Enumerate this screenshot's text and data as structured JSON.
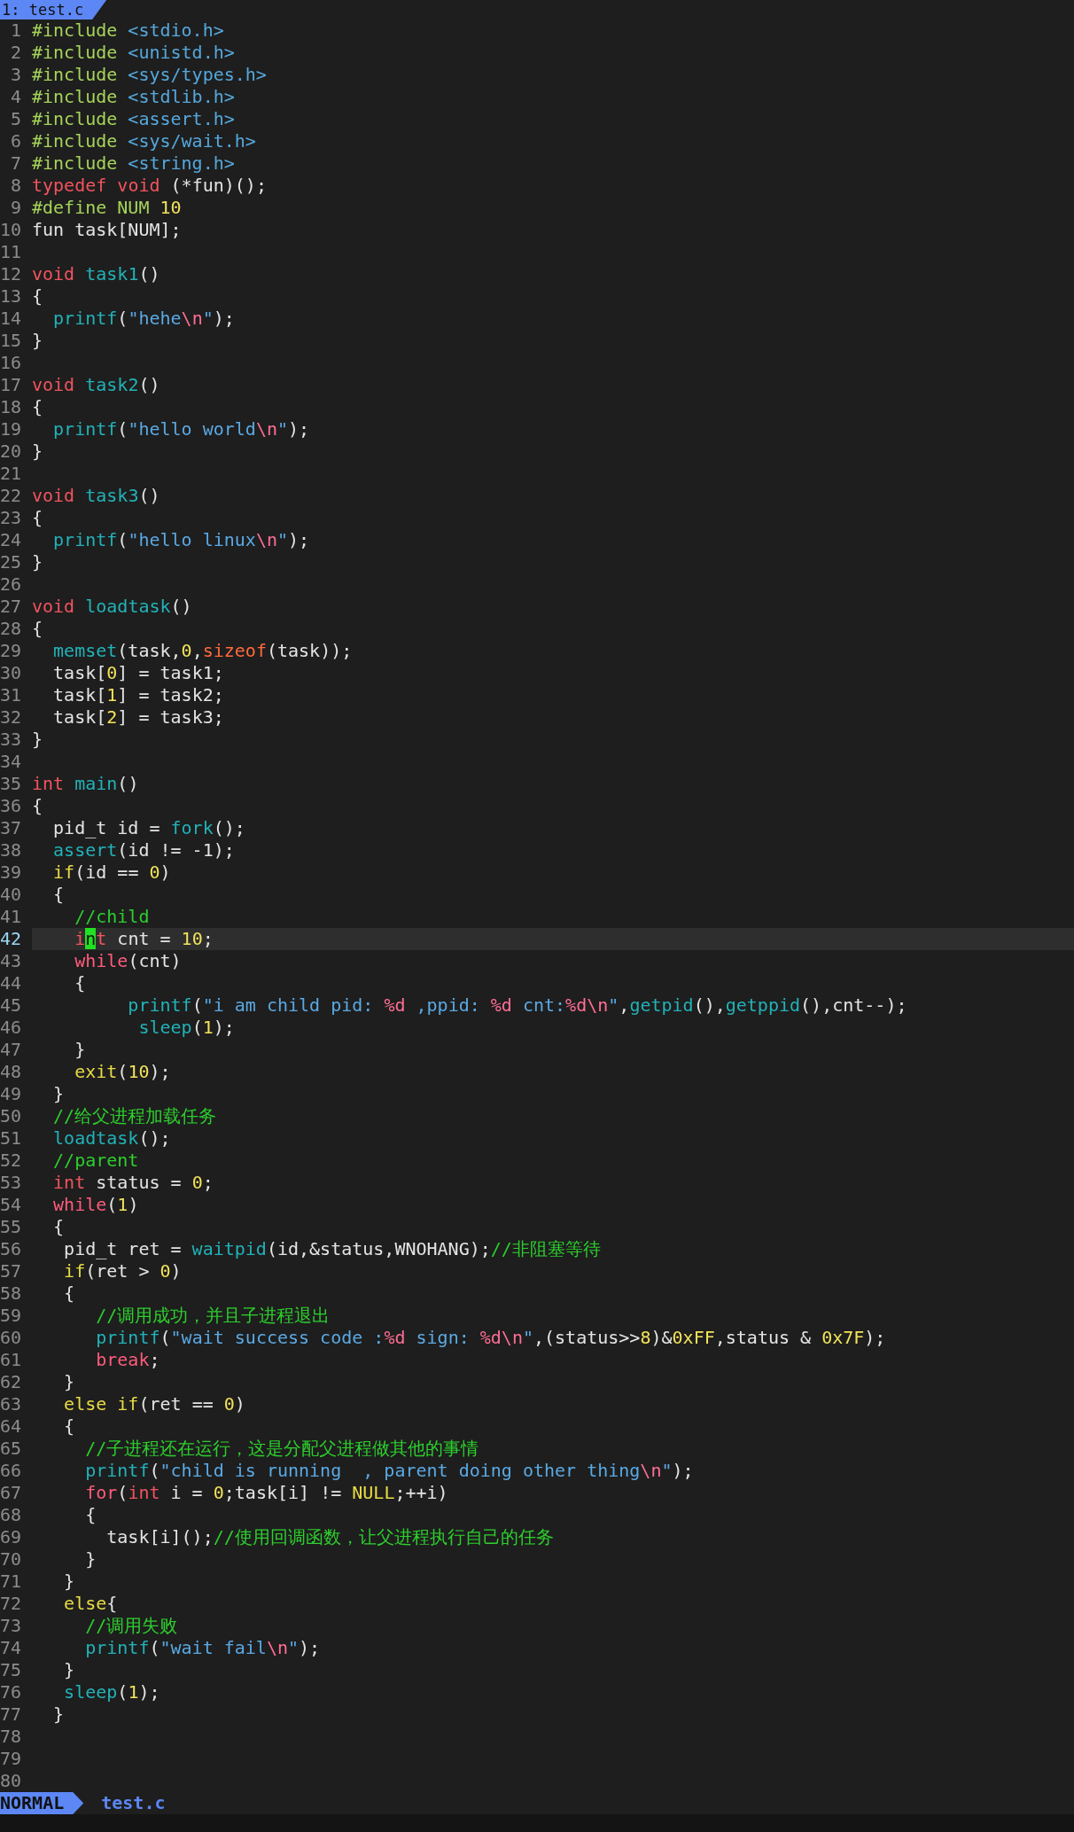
{
  "tabline": {
    "tab": "1: test.c"
  },
  "lines": [
    {
      "number": "1",
      "current": false,
      "tokens": [
        {
          "kind": "preproc",
          "text": "#include"
        },
        {
          "kind": "header",
          "text": " <stdio.h>"
        }
      ]
    },
    {
      "number": "2",
      "current": false,
      "tokens": [
        {
          "kind": "preproc",
          "text": "#include"
        },
        {
          "kind": "header",
          "text": " <unistd.h>"
        }
      ]
    },
    {
      "number": "3",
      "current": false,
      "tokens": [
        {
          "kind": "preproc",
          "text": "#include"
        },
        {
          "kind": "header",
          "text": " <sys/types.h>"
        }
      ]
    },
    {
      "number": "4",
      "current": false,
      "tokens": [
        {
          "kind": "preproc",
          "text": "#include"
        },
        {
          "kind": "header",
          "text": " <stdlib.h>"
        }
      ]
    },
    {
      "number": "5",
      "current": false,
      "tokens": [
        {
          "kind": "preproc",
          "text": "#include"
        },
        {
          "kind": "header",
          "text": " <assert.h>"
        }
      ]
    },
    {
      "number": "6",
      "current": false,
      "tokens": [
        {
          "kind": "preproc",
          "text": "#include"
        },
        {
          "kind": "header",
          "text": " <sys/wait.h>"
        }
      ]
    },
    {
      "number": "7",
      "current": false,
      "tokens": [
        {
          "kind": "preproc",
          "text": "#include"
        },
        {
          "kind": "header",
          "text": " <string.h>"
        }
      ]
    },
    {
      "number": "8",
      "current": false,
      "tokens": [
        {
          "kind": "type",
          "text": "typedef"
        },
        {
          "kind": "type",
          "text": " void"
        },
        {
          "kind": "plain",
          "text": " (*fun)();"
        }
      ]
    },
    {
      "number": "9",
      "current": false,
      "tokens": [
        {
          "kind": "preproc",
          "text": "#define NUM"
        },
        {
          "kind": "number",
          "text": " 10"
        }
      ]
    },
    {
      "number": "10",
      "current": false,
      "tokens": [
        {
          "kind": "plain",
          "text": "fun task[NUM];"
        }
      ]
    },
    {
      "number": "11",
      "current": false
    },
    {
      "number": "12",
      "current": false,
      "tokens": [
        {
          "kind": "type",
          "text": "void"
        },
        {
          "kind": "function",
          "text": " task1"
        },
        {
          "kind": "plain",
          "text": "()"
        }
      ]
    },
    {
      "number": "13",
      "current": false,
      "tokens": [
        {
          "kind": "plain",
          "text": "{"
        }
      ]
    },
    {
      "number": "14",
      "current": false,
      "tokens": [
        {
          "kind": "function",
          "text": "  printf"
        },
        {
          "kind": "plain",
          "text": "("
        },
        {
          "kind": "string",
          "text": "\"hehe"
        },
        {
          "kind": "escape",
          "text": "\\n"
        },
        {
          "kind": "string",
          "text": "\""
        },
        {
          "kind": "plain",
          "text": ");"
        }
      ]
    },
    {
      "number": "15",
      "current": false,
      "tokens": [
        {
          "kind": "plain",
          "text": "}"
        }
      ]
    },
    {
      "number": "16",
      "current": false
    },
    {
      "number": "17",
      "current": false,
      "tokens": [
        {
          "kind": "type",
          "text": "void"
        },
        {
          "kind": "function",
          "text": " task2"
        },
        {
          "kind": "plain",
          "text": "()"
        }
      ]
    },
    {
      "number": "18",
      "current": false,
      "tokens": [
        {
          "kind": "plain",
          "text": "{"
        }
      ]
    },
    {
      "number": "19",
      "current": false,
      "tokens": [
        {
          "kind": "function",
          "text": "  printf"
        },
        {
          "kind": "plain",
          "text": "("
        },
        {
          "kind": "string",
          "text": "\"hello world"
        },
        {
          "kind": "escape",
          "text": "\\n"
        },
        {
          "kind": "string",
          "text": "\""
        },
        {
          "kind": "plain",
          "text": ");"
        }
      ]
    },
    {
      "number": "20",
      "current": false,
      "tokens": [
        {
          "kind": "plain",
          "text": "}"
        }
      ]
    },
    {
      "number": "21",
      "current": false
    },
    {
      "number": "22",
      "current": false,
      "tokens": [
        {
          "kind": "type",
          "text": "void"
        },
        {
          "kind": "function",
          "text": " task3"
        },
        {
          "kind": "plain",
          "text": "()"
        }
      ]
    },
    {
      "number": "23",
      "current": false,
      "tokens": [
        {
          "kind": "plain",
          "text": "{"
        }
      ]
    },
    {
      "number": "24",
      "current": false,
      "tokens": [
        {
          "kind": "function",
          "text": "  printf"
        },
        {
          "kind": "plain",
          "text": "("
        },
        {
          "kind": "string",
          "text": "\"hello linux"
        },
        {
          "kind": "escape",
          "text": "\\n"
        },
        {
          "kind": "string",
          "text": "\""
        },
        {
          "kind": "plain",
          "text": ");"
        }
      ]
    },
    {
      "number": "25",
      "current": false,
      "tokens": [
        {
          "kind": "plain",
          "text": "}"
        }
      ]
    },
    {
      "number": "26",
      "current": false
    },
    {
      "number": "27",
      "current": false,
      "tokens": [
        {
          "kind": "type",
          "text": "void"
        },
        {
          "kind": "function",
          "text": " loadtask"
        },
        {
          "kind": "plain",
          "text": "()"
        }
      ]
    },
    {
      "number": "28",
      "current": false,
      "tokens": [
        {
          "kind": "plain",
          "text": "{"
        }
      ]
    },
    {
      "number": "29",
      "current": false,
      "tokens": [
        {
          "kind": "function",
          "text": "  memset"
        },
        {
          "kind": "plain",
          "text": "(task,"
        },
        {
          "kind": "number",
          "text": "0"
        },
        {
          "kind": "plain",
          "text": ","
        },
        {
          "kind": "operator",
          "text": "sizeof"
        },
        {
          "kind": "plain",
          "text": "(task));"
        }
      ]
    },
    {
      "number": "30",
      "current": false,
      "tokens": [
        {
          "kind": "plain",
          "text": "  task["
        },
        {
          "kind": "number",
          "text": "0"
        },
        {
          "kind": "plain",
          "text": "] = task1;"
        }
      ]
    },
    {
      "number": "31",
      "current": false,
      "tokens": [
        {
          "kind": "plain",
          "text": "  task["
        },
        {
          "kind": "number",
          "text": "1"
        },
        {
          "kind": "plain",
          "text": "] = task2;"
        }
      ]
    },
    {
      "number": "32",
      "current": false,
      "tokens": [
        {
          "kind": "plain",
          "text": "  task["
        },
        {
          "kind": "number",
          "text": "2"
        },
        {
          "kind": "plain",
          "text": "] = task3;"
        }
      ]
    },
    {
      "number": "33",
      "current": false,
      "tokens": [
        {
          "kind": "plain",
          "text": "}"
        }
      ]
    },
    {
      "number": "34",
      "current": false
    },
    {
      "number": "35",
      "current": false,
      "tokens": [
        {
          "kind": "type",
          "text": "int"
        },
        {
          "kind": "function",
          "text": " main"
        },
        {
          "kind": "plain",
          "text": "()"
        }
      ]
    },
    {
      "number": "36",
      "current": false,
      "tokens": [
        {
          "kind": "plain",
          "text": "{"
        }
      ]
    },
    {
      "number": "37",
      "current": false,
      "tokens": [
        {
          "kind": "plain",
          "text": "  pid_t id ="
        },
        {
          "kind": "function",
          "text": " fork"
        },
        {
          "kind": "plain",
          "text": "();"
        }
      ]
    },
    {
      "number": "38",
      "current": false,
      "tokens": [
        {
          "kind": "function",
          "text": "  assert"
        },
        {
          "kind": "plain",
          "text": "(id != -1);"
        }
      ]
    },
    {
      "number": "39",
      "current": false,
      "tokens": [
        {
          "kind": "conditional",
          "text": "  if"
        },
        {
          "kind": "plain",
          "text": "(id =="
        },
        {
          "kind": "number",
          "text": " 0"
        },
        {
          "kind": "plain",
          "text": ")"
        }
      ]
    },
    {
      "number": "40",
      "current": false,
      "tokens": [
        {
          "kind": "plain",
          "text": "  {"
        }
      ]
    },
    {
      "number": "41",
      "current": false,
      "tokens": [
        {
          "kind": "comment",
          "text": "    //child"
        }
      ]
    },
    {
      "number": "42",
      "current": true,
      "tokens": [
        {
          "kind": "type",
          "text": "    i"
        },
        {
          "kind": "cursor",
          "text": "n"
        },
        {
          "kind": "type",
          "text": "t"
        },
        {
          "kind": "plain",
          "text": " cnt ="
        },
        {
          "kind": "number",
          "text": " 10"
        },
        {
          "kind": "plain",
          "text": ";"
        }
      ]
    },
    {
      "number": "43",
      "current": false,
      "tokens": [
        {
          "kind": "keyword",
          "text": "    while"
        },
        {
          "kind": "plain",
          "text": "(cnt)"
        }
      ]
    },
    {
      "number": "44",
      "current": false,
      "tokens": [
        {
          "kind": "plain",
          "text": "    {"
        }
      ]
    },
    {
      "number": "45",
      "current": false,
      "tokens": [
        {
          "kind": "function",
          "text": "         printf"
        },
        {
          "kind": "plain",
          "text": "("
        },
        {
          "kind": "string",
          "text": "\"i am child pid: "
        },
        {
          "kind": "escape",
          "text": "%d"
        },
        {
          "kind": "string",
          "text": " ,ppid: "
        },
        {
          "kind": "escape",
          "text": "%d"
        },
        {
          "kind": "string",
          "text": " cnt:"
        },
        {
          "kind": "escape",
          "text": "%d\\n"
        },
        {
          "kind": "string",
          "text": "\""
        },
        {
          "kind": "plain",
          "text": ","
        },
        {
          "kind": "function",
          "text": "getpid"
        },
        {
          "kind": "plain",
          "text": "(),"
        },
        {
          "kind": "function",
          "text": "getppid"
        },
        {
          "kind": "plain",
          "text": "(),cnt--);"
        }
      ]
    },
    {
      "number": "46",
      "current": false,
      "tokens": [
        {
          "kind": "function",
          "text": "          sleep"
        },
        {
          "kind": "plain",
          "text": "("
        },
        {
          "kind": "number",
          "text": "1"
        },
        {
          "kind": "plain",
          "text": ");"
        }
      ]
    },
    {
      "number": "47",
      "current": false,
      "tokens": [
        {
          "kind": "plain",
          "text": "    }"
        }
      ]
    },
    {
      "number": "48",
      "current": false,
      "tokens": [
        {
          "kind": "conditional",
          "text": "    exit"
        },
        {
          "kind": "plain",
          "text": "("
        },
        {
          "kind": "number",
          "text": "10"
        },
        {
          "kind": "plain",
          "text": ");"
        }
      ]
    },
    {
      "number": "49",
      "current": false,
      "tokens": [
        {
          "kind": "plain",
          "text": "  }"
        }
      ]
    },
    {
      "number": "50",
      "current": false,
      "tokens": [
        {
          "kind": "comment",
          "text": "  //给父进程加载任务"
        }
      ]
    },
    {
      "number": "51",
      "current": false,
      "tokens": [
        {
          "kind": "function",
          "text": "  loadtask"
        },
        {
          "kind": "plain",
          "text": "();"
        }
      ]
    },
    {
      "number": "52",
      "current": false,
      "tokens": [
        {
          "kind": "comment",
          "text": "  //parent"
        }
      ]
    },
    {
      "number": "53",
      "current": false,
      "tokens": [
        {
          "kind": "type",
          "text": "  int"
        },
        {
          "kind": "plain",
          "text": " status ="
        },
        {
          "kind": "number",
          "text": " 0"
        },
        {
          "kind": "plain",
          "text": ";"
        }
      ]
    },
    {
      "number": "54",
      "current": false,
      "tokens": [
        {
          "kind": "keyword",
          "text": "  while"
        },
        {
          "kind": "plain",
          "text": "("
        },
        {
          "kind": "number",
          "text": "1"
        },
        {
          "kind": "plain",
          "text": ")"
        }
      ]
    },
    {
      "number": "55",
      "current": false,
      "tokens": [
        {
          "kind": "plain",
          "text": "  {"
        }
      ]
    },
    {
      "number": "56",
      "current": false,
      "tokens": [
        {
          "kind": "plain",
          "text": "   pid_t ret ="
        },
        {
          "kind": "function",
          "text": " waitpid"
        },
        {
          "kind": "plain",
          "text": "(id,&status,WNOHANG);"
        },
        {
          "kind": "comment",
          "text": "//非阻塞等待"
        }
      ]
    },
    {
      "number": "57",
      "current": false,
      "tokens": [
        {
          "kind": "conditional",
          "text": "   if"
        },
        {
          "kind": "plain",
          "text": "(ret >"
        },
        {
          "kind": "number",
          "text": " 0"
        },
        {
          "kind": "plain",
          "text": ")"
        }
      ]
    },
    {
      "number": "58",
      "current": false,
      "tokens": [
        {
          "kind": "plain",
          "text": "   {"
        }
      ]
    },
    {
      "number": "59",
      "current": false,
      "tokens": [
        {
          "kind": "comment",
          "text": "      //调用成功，并且子进程退出"
        }
      ]
    },
    {
      "number": "60",
      "current": false,
      "tokens": [
        {
          "kind": "function",
          "text": "      printf"
        },
        {
          "kind": "plain",
          "text": "("
        },
        {
          "kind": "string",
          "text": "\"wait success code :"
        },
        {
          "kind": "escape",
          "text": "%d"
        },
        {
          "kind": "string",
          "text": " sign: "
        },
        {
          "kind": "escape",
          "text": "%d\\n"
        },
        {
          "kind": "string",
          "text": "\""
        },
        {
          "kind": "plain",
          "text": ",(status>>"
        },
        {
          "kind": "number",
          "text": "8"
        },
        {
          "kind": "plain",
          "text": ")&"
        },
        {
          "kind": "number",
          "text": "0xFF"
        },
        {
          "kind": "plain",
          "text": ",status &"
        },
        {
          "kind": "number",
          "text": " 0x7F"
        },
        {
          "kind": "plain",
          "text": ");"
        }
      ]
    },
    {
      "number": "61",
      "current": false,
      "tokens": [
        {
          "kind": "keyword",
          "text": "      break"
        },
        {
          "kind": "plain",
          "text": ";"
        }
      ]
    },
    {
      "number": "62",
      "current": false,
      "tokens": [
        {
          "kind": "plain",
          "text": "   }"
        }
      ]
    },
    {
      "number": "63",
      "current": false,
      "tokens": [
        {
          "kind": "conditional",
          "text": "   else if"
        },
        {
          "kind": "plain",
          "text": "(ret =="
        },
        {
          "kind": "number",
          "text": " 0"
        },
        {
          "kind": "plain",
          "text": ")"
        }
      ]
    },
    {
      "number": "64",
      "current": false,
      "tokens": [
        {
          "kind": "plain",
          "text": "   {"
        }
      ]
    },
    {
      "number": "65",
      "current": false,
      "tokens": [
        {
          "kind": "comment",
          "text": "     //子进程还在运行，这是分配父进程做其他的事情"
        }
      ]
    },
    {
      "number": "66",
      "current": false,
      "tokens": [
        {
          "kind": "function",
          "text": "     printf"
        },
        {
          "kind": "plain",
          "text": "("
        },
        {
          "kind": "string",
          "text": "\"child is running  , parent doing other thing"
        },
        {
          "kind": "escape",
          "text": "\\n"
        },
        {
          "kind": "string",
          "text": "\""
        },
        {
          "kind": "plain",
          "text": ");"
        }
      ]
    },
    {
      "number": "67",
      "current": false,
      "tokens": [
        {
          "kind": "keyword",
          "text": "     for"
        },
        {
          "kind": "plain",
          "text": "("
        },
        {
          "kind": "type",
          "text": "int"
        },
        {
          "kind": "plain",
          "text": " i ="
        },
        {
          "kind": "number",
          "text": " 0"
        },
        {
          "kind": "plain",
          "text": ";task[i] !="
        },
        {
          "kind": "conditional",
          "text": " NULL"
        },
        {
          "kind": "plain",
          "text": ";++i)"
        }
      ]
    },
    {
      "number": "68",
      "current": false,
      "tokens": [
        {
          "kind": "plain",
          "text": "     {"
        }
      ]
    },
    {
      "number": "69",
      "current": false,
      "tokens": [
        {
          "kind": "plain",
          "text": "       task[i]();"
        },
        {
          "kind": "comment",
          "text": "//使用回调函数，让父进程执行自己的任务"
        }
      ]
    },
    {
      "number": "70",
      "current": false,
      "tokens": [
        {
          "kind": "plain",
          "text": "     }"
        }
      ]
    },
    {
      "number": "71",
      "current": false,
      "tokens": [
        {
          "kind": "plain",
          "text": "   }"
        }
      ]
    },
    {
      "number": "72",
      "current": false,
      "tokens": [
        {
          "kind": "conditional",
          "text": "   else"
        },
        {
          "kind": "plain",
          "text": "{"
        }
      ]
    },
    {
      "number": "73",
      "current": false,
      "tokens": [
        {
          "kind": "comment",
          "text": "     //调用失败"
        }
      ]
    },
    {
      "number": "74",
      "current": false,
      "tokens": [
        {
          "kind": "function",
          "text": "     printf"
        },
        {
          "kind": "plain",
          "text": "("
        },
        {
          "kind": "string",
          "text": "\"wait fail"
        },
        {
          "kind": "escape",
          "text": "\\n"
        },
        {
          "kind": "string",
          "text": "\""
        },
        {
          "kind": "plain",
          "text": ");"
        }
      ]
    },
    {
      "number": "75",
      "current": false,
      "tokens": [
        {
          "kind": "plain",
          "text": "   }"
        }
      ]
    },
    {
      "number": "76",
      "current": false,
      "tokens": [
        {
          "kind": "function",
          "text": "   sleep"
        },
        {
          "kind": "plain",
          "text": "("
        },
        {
          "kind": "number",
          "text": "1"
        },
        {
          "kind": "plain",
          "text": ");"
        }
      ]
    },
    {
      "number": "77",
      "current": false,
      "tokens": [
        {
          "kind": "plain",
          "text": "  }"
        }
      ]
    },
    {
      "number": "78",
      "current": false
    },
    {
      "number": "79",
      "current": false
    },
    {
      "number": "80",
      "current": false
    }
  ],
  "status_bar": {
    "mode": "NORMAL",
    "file": "test.c"
  }
}
